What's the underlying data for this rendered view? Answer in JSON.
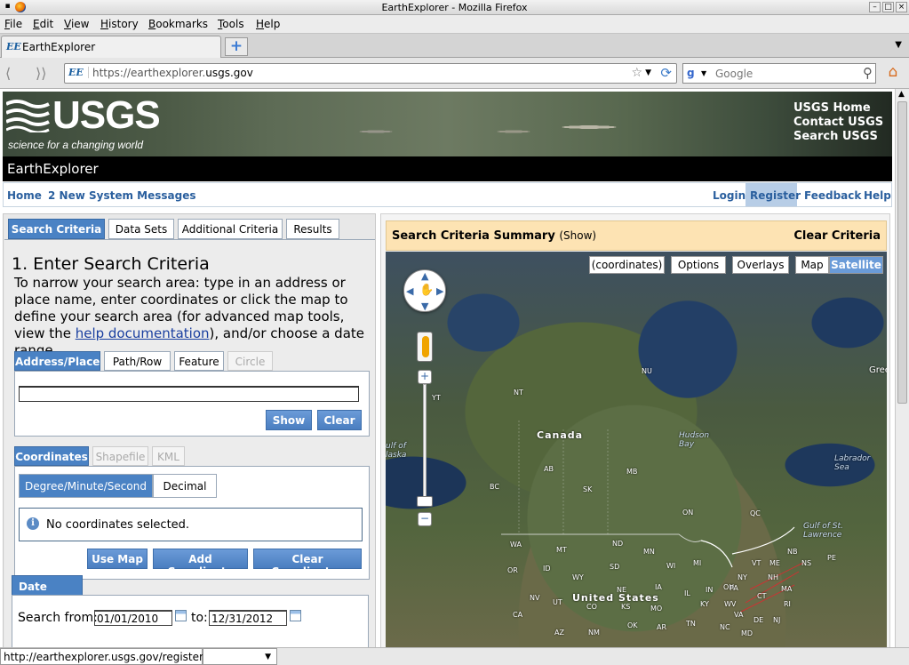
{
  "window": {
    "title": "EarthExplorer - Mozilla Firefox"
  },
  "menubar": {
    "items": [
      "File",
      "Edit",
      "View",
      "History",
      "Bookmarks",
      "Tools",
      "Help"
    ]
  },
  "tab": {
    "favicon": "EE",
    "label": "EarthExplorer"
  },
  "navbar": {
    "url_prefix": "https://earthexplorer.",
    "url_domain": "usgs.gov",
    "search_engine_icon": "g-icon",
    "search_placeholder": "Google"
  },
  "banner": {
    "logo": "USGS",
    "tagline": "science for a changing world",
    "links": [
      "USGS Home",
      "Contact USGS",
      "Search USGS"
    ]
  },
  "app_title": "EarthExplorer",
  "sitenav": {
    "left": [
      "Home",
      "2 New System Messages"
    ],
    "right": [
      "Login",
      "Register",
      "Feedback",
      "Help"
    ]
  },
  "criteria_tabs": [
    "Search Criteria",
    "Data Sets",
    "Additional Criteria",
    "Results"
  ],
  "step": {
    "title": "1. Enter Search Criteria",
    "desc_before": "To narrow your search area: type in an address or place name, enter coordinates or click the map to define your search area (for advanced map tools, view the ",
    "desc_link": "help documentation",
    "desc_after": "), and/or choose a date range."
  },
  "address_tabs": [
    "Address/Place",
    "Path/Row",
    "Feature",
    "Circle"
  ],
  "address": {
    "value": "",
    "show_label": "Show",
    "clear_label": "Clear"
  },
  "coord_tabs": [
    "Coordinates",
    "Shapefile",
    "KML"
  ],
  "coords": {
    "mode_dms": "Degree/Minute/Second",
    "mode_decimal": "Decimal",
    "message": "No coordinates selected.",
    "use_map": "Use Map",
    "add_coordinate": "Add Coordinate",
    "clear_coordinates": "Clear Coordinates"
  },
  "date_range": {
    "heading": "Date Range",
    "from_label": "Search from:",
    "from_value": "01/01/2010",
    "to_label": "to:",
    "to_value": "12/31/2012"
  },
  "summary": {
    "title": "Search Criteria Summary",
    "show": "(Show)",
    "clear": "Clear Criteria"
  },
  "map": {
    "buttons": [
      "(coordinates)",
      "Options",
      "Overlays",
      "Map",
      "Satellite"
    ],
    "active_button": "Satellite",
    "labels": {
      "canada": "Canada",
      "us": "United States",
      "hudson": "Hudson Bay",
      "labrador": "Labrador Sea",
      "gulf_law": "Gulf of St. Lawrence",
      "gulf_ak": "ulf of laska",
      "greenland": "Gree",
      "provinces": [
        "NU",
        "NT",
        "YT",
        "AB",
        "SK",
        "MB",
        "BC",
        "ON",
        "QC",
        "NB",
        "NS",
        "PE"
      ],
      "states": [
        "WA",
        "MT",
        "ND",
        "MN",
        "OR",
        "ID",
        "SD",
        "WI",
        "MI",
        "VT",
        "ME",
        "NH",
        "NY",
        "MA",
        "WY",
        "NE",
        "IA",
        "IL",
        "IN",
        "OH",
        "PA",
        "CT",
        "RI",
        "NJ",
        "DE",
        "MD",
        "NV",
        "UT",
        "CO",
        "KS",
        "MO",
        "KY",
        "WV",
        "VA",
        "CA",
        "AZ",
        "NM",
        "OK",
        "AR",
        "TN",
        "NC"
      ]
    }
  },
  "statusbar": {
    "text": "http://earthexplorer.usgs.gov/register/"
  }
}
